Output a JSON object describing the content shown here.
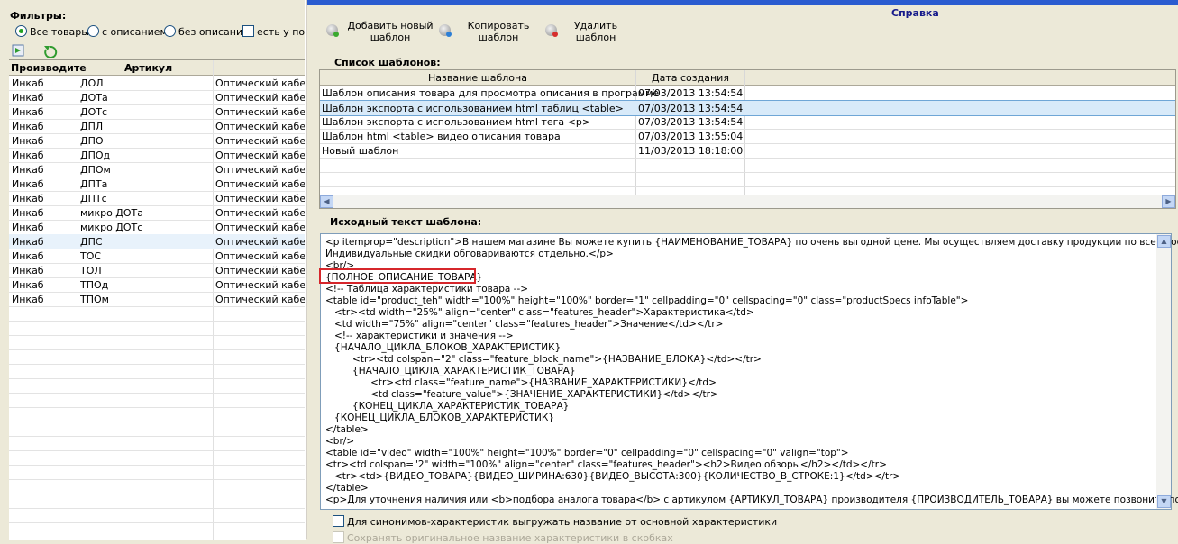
{
  "left": {
    "filters_title": "Фильтры:",
    "filter_options": [
      "Все товары",
      "с описанием",
      "без описания",
      "есть у пос"
    ],
    "columns": [
      "Производите",
      "Артикул"
    ],
    "rows": [
      [
        "Инкаб",
        "ДОЛ",
        "Оптический кабель"
      ],
      [
        "Инкаб",
        "ДОТа",
        "Оптический кабель"
      ],
      [
        "Инкаб",
        "ДОТс",
        "Оптический кабель"
      ],
      [
        "Инкаб",
        "ДПЛ",
        "Оптический кабель"
      ],
      [
        "Инкаб",
        "ДПО",
        "Оптический кабель"
      ],
      [
        "Инкаб",
        "ДПОд",
        "Оптический кабель"
      ],
      [
        "Инкаб",
        "ДПОм",
        "Оптический кабель"
      ],
      [
        "Инкаб",
        "ДПТа",
        "Оптический кабель"
      ],
      [
        "Инкаб",
        "ДПТс",
        "Оптический кабель"
      ],
      [
        "Инкаб",
        "микро ДОТа",
        "Оптический кабель"
      ],
      [
        "Инкаб",
        "микро ДОТс",
        "Оптический кабель"
      ],
      [
        "Инкаб",
        "ДПС",
        "Оптический кабель"
      ],
      [
        "Инкаб",
        "ТОС",
        "Оптический кабель"
      ],
      [
        "Инкаб",
        "ТОЛ",
        "Оптический кабель"
      ],
      [
        "Инкаб",
        "ТПОд",
        "Оптический кабель"
      ],
      [
        "Инкаб",
        "ТПОм",
        "Оптический кабель"
      ]
    ]
  },
  "right": {
    "help": "Справка",
    "toolbar": {
      "add": [
        "Добавить новый",
        "шаблон"
      ],
      "copy": [
        "Копировать",
        "шаблон"
      ],
      "delete": [
        "Удалить",
        "шаблон"
      ]
    },
    "templates_label": "Список шаблонов:",
    "templates_columns": [
      "Название шаблона",
      "Дата создания"
    ],
    "templates": [
      [
        "Шаблон описания товара для просмотра описания в программе",
        "07/03/2013 13:54:54"
      ],
      [
        "Шаблон экспорта с использованием html таблиц <table>",
        "07/03/2013 13:54:54"
      ],
      [
        "Шаблон экспорта с использованием html тега <p>",
        "07/03/2013 13:54:54"
      ],
      [
        "Шаблон html <table> видео описания товара",
        "07/03/2013 13:55:04"
      ],
      [
        "Новый шаблон",
        "11/03/2013 18:18:00"
      ]
    ],
    "source_label": "Исходный текст шаблона:",
    "source_lines": [
      "<p itemprop=\"description\">В нашем магазине Вы можете купить {НАИМЕНОВАНИЕ_ТОВАРА} по очень выгодной цене. Мы осуществляем доставку продукции по всей России.",
      "Индивидуальные скидки обговариваются отдельно.</p>",
      "<br/>",
      "{ПОЛНОЕ_ОПИСАНИЕ_ТОВАРА}",
      "<!-- Таблица характеристики товара -->",
      "<table id=\"product_teh\" width=\"100%\" height=\"100%\" border=\"1\" cellpadding=\"0\" cellspacing=\"0\" class=\"productSpecs infoTable\">",
      "   <tr><td width=\"25%\" align=\"center\" class=\"features_header\">Характеристика</td>",
      "   <td width=\"75%\" align=\"center\" class=\"features_header\">Значение</td></tr>",
      "   <!-- характеристики и значения -->",
      "   {НАЧАЛО_ЦИКЛА_БЛОКОВ_ХАРАКТЕРИСТИК}",
      "         <tr><td colspan=\"2\" class=\"feature_block_name\">{НАЗВАНИЕ_БЛОКА}</td></tr>",
      "         {НАЧАЛО_ЦИКЛА_ХАРАКТЕРИСТИК_ТОВАРА}",
      "               <tr><td class=\"feature_name\">{НАЗВАНИЕ_ХАРАКТЕРИСТИКИ}</td>",
      "               <td class=\"feature_value\">{ЗНАЧЕНИЕ_ХАРАКТЕРИСТИКИ}</td></tr>",
      "         {КОНЕЦ_ЦИКЛА_ХАРАКТЕРИСТИК_ТОВАРА}",
      "   {КОНЕЦ_ЦИКЛА_БЛОКОВ_ХАРАКТЕРИСТИК}",
      "</table>",
      "<br/>",
      "<table id=\"video\" width=\"100%\" height=\"100%\" border=\"0\" cellpadding=\"0\" cellspacing=\"0\" valign=\"top\">",
      "<tr><td colspan=\"2\" width=\"100%\" align=\"center\" class=\"features_header\"><h2>Видео обзоры</h2></td></tr>",
      "   <tr><td>{ВИДЕО_ТОВАРА}{ВИДЕО_ШИРИНА:630}{ВИДЕО_ВЫСОТА:300}{КОЛИЧЕСТВО_В_СТРОКЕ:1}</td></tr>",
      "</table>",
      "<p>Для уточнения наличия или <b>подбора аналога товара</b> с артикулом {АРТИКУЛ_ТОВАРА} производителя {ПРОИЗВОДИТЕЛЬ_ТОВАРА} вы можете позвонить по"
    ],
    "option1": "Для синонимов-характеристик выгружать название от основной характеристики",
    "option2": "Сохранять оригинальное название характеристики в скобках"
  }
}
